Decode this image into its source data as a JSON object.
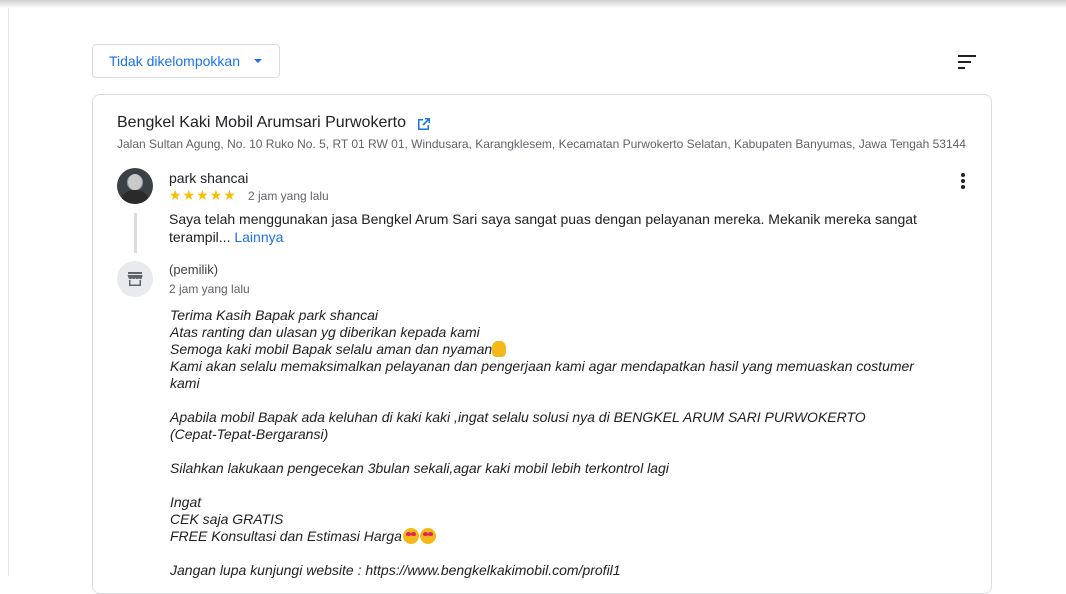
{
  "toolbar": {
    "group_label": "Tidak dikelompokkan",
    "sort_icon": "sort-icon"
  },
  "business": {
    "name": "Bengkel Kaki Mobil Arumsari Purwokerto",
    "address": "Jalan Sultan Agung, No. 10 Ruko No. 5, RT 01 RW 01, Windusara, Karangklesem, Kecamatan Purwokerto Selatan, Kabupaten Banyumas, Jawa Tengah 53144"
  },
  "review": {
    "reviewer": "park shancai",
    "stars": "★★★★★",
    "rating": 5,
    "time": "2 jam yang lalu",
    "text": "Saya telah menggunakan jasa Bengkel Arum Sari saya sangat puas dengan pelayanan mereka. Mekanik mereka sangat terampil... ",
    "more_link": "Lainnya"
  },
  "owner": {
    "label": "(pemilik)",
    "time": "2 jam yang lalu",
    "reply_lines": [
      "Terima Kasih Bapak park shancai",
      "Atas ranting dan ulasan yg diberikan kepada kami",
      "Semoga kaki mobil Bapak selalu aman dan nyaman",
      "Kami akan selalu memaksimalkan pelayanan dan pengerjaan kami agar mendapatkan hasil yang memuaskan costumer kami",
      "",
      "Apabila mobil Bapak ada keluhan di kaki kaki ,ingat selalu solusi nya di BENGKEL ARUM SARI PURWOKERTO",
      "(Cepat-Tepat-Bergaransi)",
      "",
      "Silahkan lakukaan pengecekan 3bulan sekali,agar kaki mobil lebih terkontrol lagi",
      "",
      "Ingat",
      "CEK saja GRATIS",
      "FREE Konsultasi dan Estimasi Harga",
      "",
      "Jangan lupa kunjungi website : https://www.bengkelkakimobil.com/profil1"
    ]
  }
}
